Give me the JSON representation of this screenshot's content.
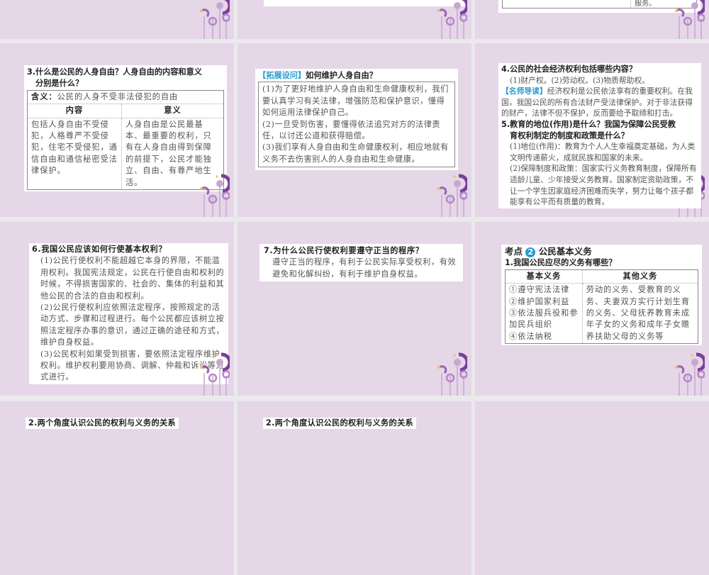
{
  "slides": {
    "top_right": {
      "cell": "服务。"
    },
    "s3": {
      "q": "3.什么是公民的人身自由？人身自由的内容和意义",
      "q2": "分别是什么？",
      "def_label": "含义：",
      "def": "公民的人身不受非法侵犯的自由",
      "col1": "内容",
      "col2": "意义",
      "c1": "包括人身自由不受侵犯，人格尊严不受侵犯，住宅不受侵犯，通信自由和通信秘密受法律保护。",
      "c2": "人身自由是公民最基本、最重要的权利，只有在人身自由得到保障的前提下，公民才能独立、自由、有尊严地生活。"
    },
    "ext": {
      "tag": "【拓展设问】",
      "q": "如何维护人身自由？",
      "p1": "(1)为了更好地维护人身自由和生命健康权利，我们要认真学习有关法律，增强防范和保护意识，懂得如何运用法律保护自己。",
      "p2": "(2)一旦受到伤害，要懂得依法追究对方的法律责任，以讨还公道和获得赔偿。",
      "p3": "(3)我们享有人身自由和生命健康权利，相应地就有义务不去伤害别人的人身自由和生命健康。"
    },
    "s45": {
      "q4": "4.公民的社会经济权利包括哪些内容？",
      "a4": "(1)财产权。(2)劳动权。(3)物质帮助权。",
      "tag": "【名师导读】",
      "note": "经济权利是公民依法享有的重要权利。在我国，我国公民的所有合法财产受法律保护。对于非法获得的财产，法律不但不保护，反而要给予取缔和打击。",
      "q5": "5.教育的地位(作用)是什么？我国为保障公民受教",
      "q5b": "育权利制定的制度和政策是什么？",
      "a5a": "(1)地位(作用)：教育为个人人生幸福奠定基础，为人类文明传递薪火，成就民族和国家的未来。",
      "a5b": "(2)保障制度和政策：国家实行义务教育制度，保障所有适龄儿童、少年接受义务教育。国家制定资助政策，不让一个学生因家庭经济困难而失学，努力让每个孩子都能享有公平而有质量的教育。"
    },
    "s6": {
      "q": "6.我国公民应该如何行使基本权利？",
      "p1": "(1)公民行使权利不能超越它本身的界限，不能滥用权利。我国宪法规定，公民在行使自由和权利的时候，不得损害国家的、社会的、集体的利益和其他公民的合法的自由和权利。",
      "p2": "(2)公民行使权利应依照法定程序，按照规定的活动方式、步骤和过程进行。每个公民都应该树立按照法定程序办事的意识，通过正确的途径和方式，维护自身权益。",
      "p3": "(3)公民权利如果受到损害，要依照法定程序维护权利。维护权利要用协商、调解、仲裁和诉讼等方式进行。"
    },
    "s7": {
      "q": "7.为什么公民行使权利要遵守正当的程序？",
      "a": "遵守正当的程序，有利于公民实际享受权利，有效避免和化解纠纷，有利于维护自身权益。"
    },
    "k2": {
      "pre": "考点",
      "num": "2",
      "title": "公民基本义务",
      "q": "1.我国公民应尽的义务有哪些？",
      "col1": "基本义务",
      "col2": "其他义务",
      "items": [
        "①遵守宪法法律",
        "②维护国家利益",
        "③依法服兵役和参加民兵组织",
        "④依法纳税"
      ],
      "other": "劳动的义务、受教育的义务、夫妻双方实行计划生育的义务、父母抚养教育未成年子女的义务和成年子女赡养扶助父母的义务等"
    },
    "r4": {
      "a": "2.两个角度认识公民的权利与义务的关系",
      "b": "2.两个角度认识公民的权利与义务的关系"
    }
  },
  "colors": {
    "slide_bg": "#e5d6e8",
    "accent": "#2a9bd0",
    "deco": "#7a3f98"
  }
}
